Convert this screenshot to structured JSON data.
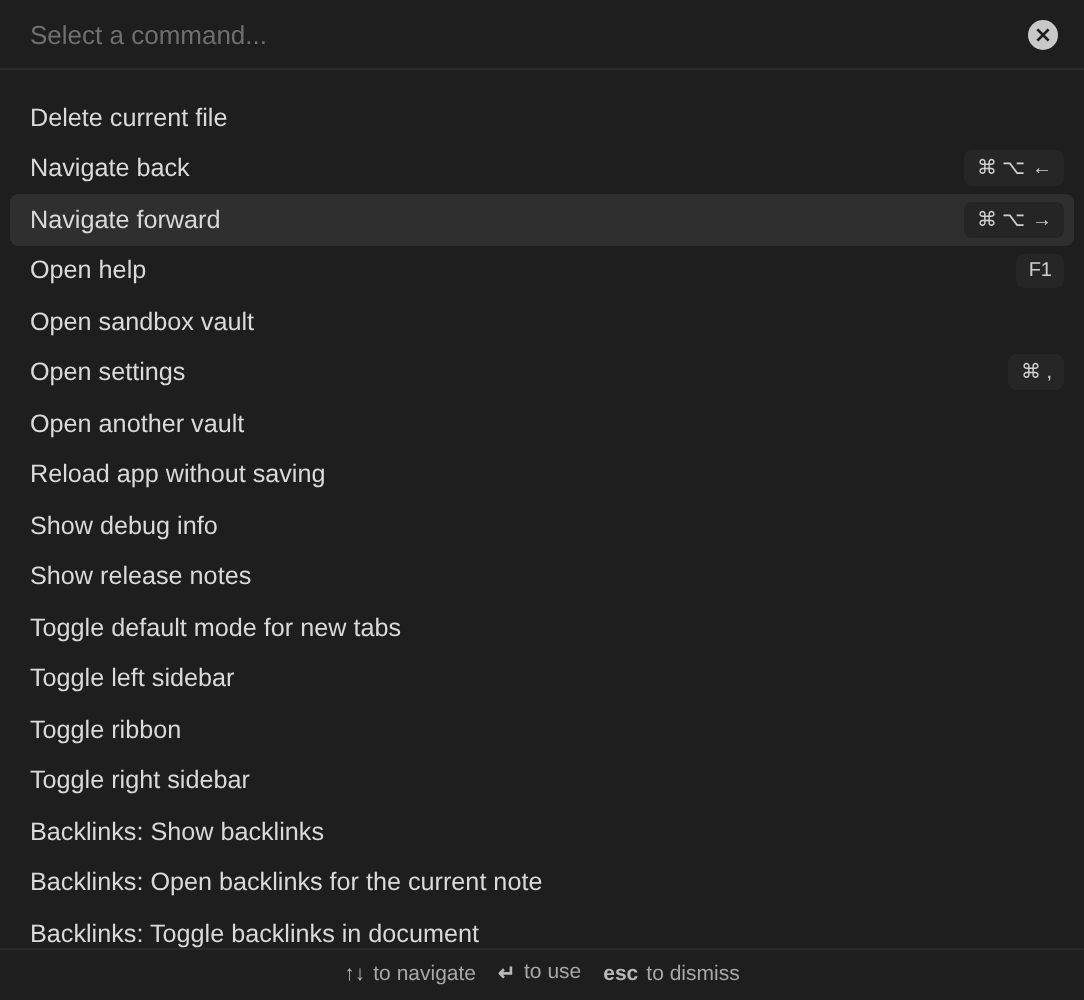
{
  "search": {
    "placeholder": "Select a command..."
  },
  "commands": [
    {
      "label": "Delete current file",
      "selected": false
    },
    {
      "label": "Navigate back",
      "selected": false,
      "hotkey": "⌘ ⌥ ←"
    },
    {
      "label": "Navigate forward",
      "selected": true,
      "hotkey": "⌘ ⌥ →"
    },
    {
      "label": "Open help",
      "selected": false,
      "hotkey": "F1"
    },
    {
      "label": "Open sandbox vault",
      "selected": false
    },
    {
      "label": "Open settings",
      "selected": false,
      "hotkey": "⌘ ,"
    },
    {
      "label": "Open another vault",
      "selected": false
    },
    {
      "label": "Reload app without saving",
      "selected": false
    },
    {
      "label": "Show debug info",
      "selected": false
    },
    {
      "label": "Show release notes",
      "selected": false
    },
    {
      "label": "Toggle default mode for new tabs",
      "selected": false
    },
    {
      "label": "Toggle left sidebar",
      "selected": false
    },
    {
      "label": "Toggle ribbon",
      "selected": false
    },
    {
      "label": "Toggle right sidebar",
      "selected": false
    },
    {
      "label": "Backlinks: Show backlinks",
      "selected": false
    },
    {
      "label": "Backlinks: Open backlinks for the current note",
      "selected": false
    },
    {
      "label": "Backlinks: Toggle backlinks in document",
      "selected": false
    }
  ],
  "instructions": [
    {
      "key": "↑↓",
      "text": "to navigate"
    },
    {
      "key": "↵",
      "text": "to use"
    },
    {
      "key": "esc",
      "text": "to dismiss"
    }
  ]
}
